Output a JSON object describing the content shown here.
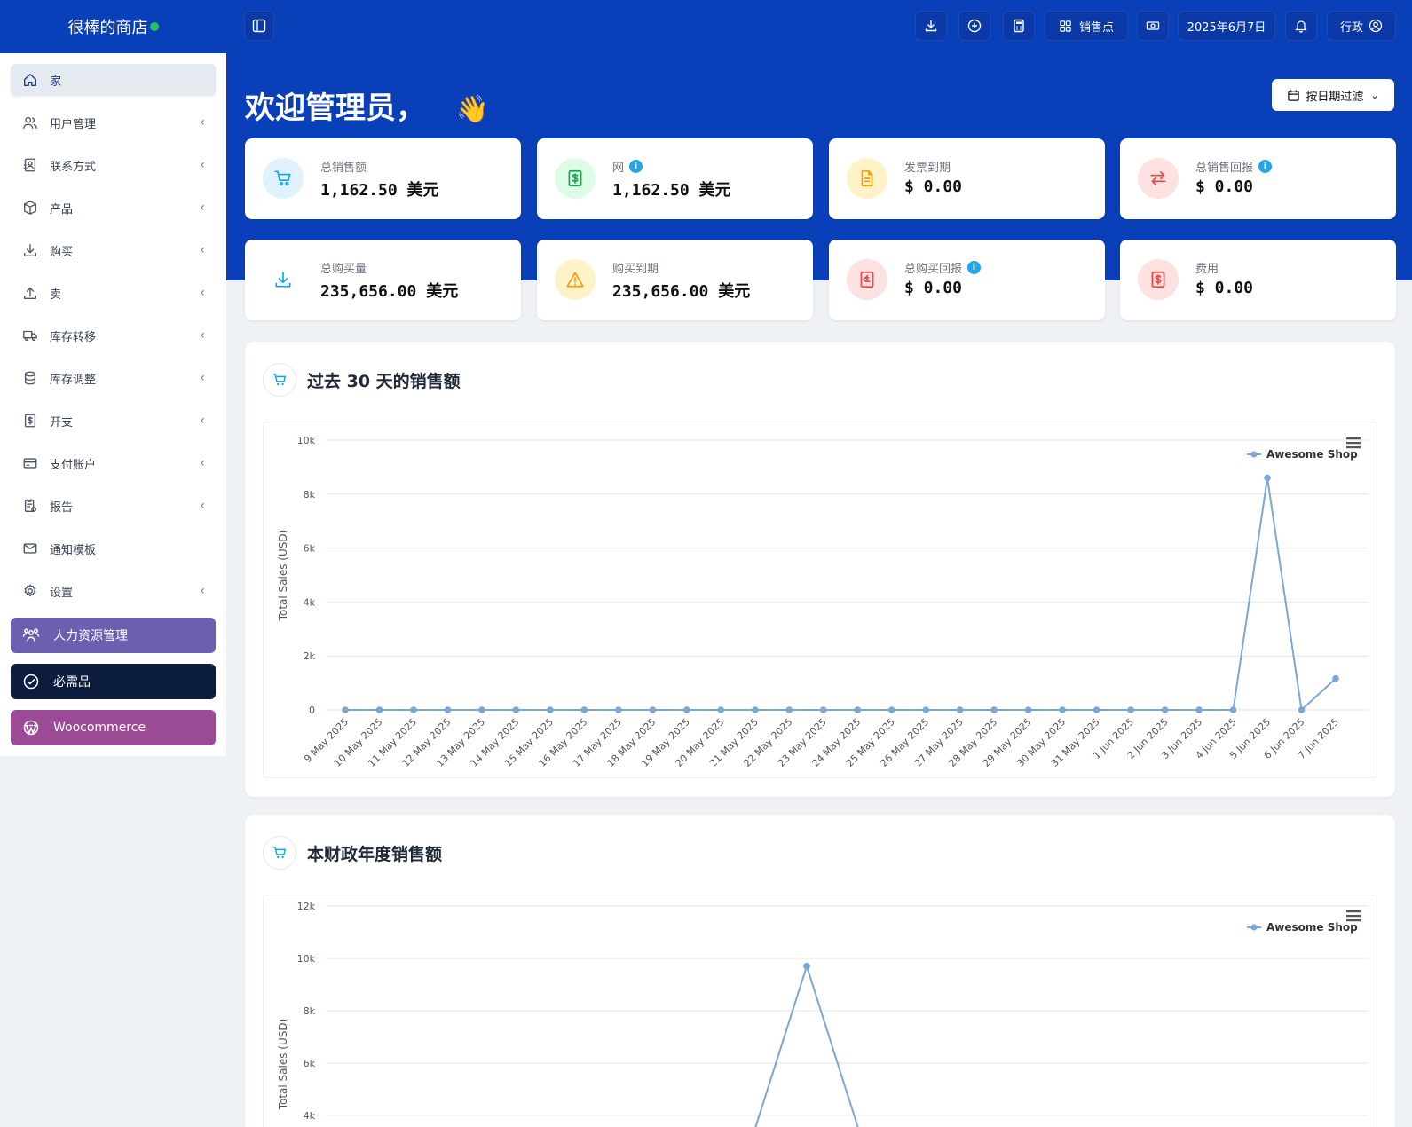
{
  "brand": {
    "name": "很棒的商店"
  },
  "sidebar": {
    "items": [
      {
        "label": "家",
        "icon": "home-icon",
        "active": true,
        "chevron": false
      },
      {
        "label": "用户管理",
        "icon": "users-icon",
        "chevron": true
      },
      {
        "label": "联系方式",
        "icon": "contact-icon",
        "chevron": true
      },
      {
        "label": "产品",
        "icon": "box-icon",
        "chevron": true
      },
      {
        "label": "购买",
        "icon": "download-icon",
        "chevron": true
      },
      {
        "label": "卖",
        "icon": "upload-icon",
        "chevron": true
      },
      {
        "label": "库存转移",
        "icon": "truck-icon",
        "chevron": true
      },
      {
        "label": "库存调整",
        "icon": "database-icon",
        "chevron": true
      },
      {
        "label": "开支",
        "icon": "receipt-icon",
        "chevron": true
      },
      {
        "label": "支付账户",
        "icon": "card-icon",
        "chevron": true
      },
      {
        "label": "报告",
        "icon": "report-icon",
        "chevron": true
      },
      {
        "label": "通知模板",
        "icon": "mail-icon",
        "chevron": false
      },
      {
        "label": "设置",
        "icon": "gear-icon",
        "chevron": true
      }
    ],
    "chevron_glyph": "‹",
    "special": [
      {
        "label": "人力资源管理",
        "icon": "team-icon",
        "color": "#6b5fb0"
      },
      {
        "label": "必需品",
        "icon": "check-circle-icon",
        "color": "#0b1c3d"
      },
      {
        "label": "Woocommerce",
        "icon": "wordpress-icon",
        "color": "#9b4a96"
      }
    ]
  },
  "header": {
    "pos_label": "销售点",
    "date": "2025年6月7日",
    "user": "行政"
  },
  "welcome": {
    "text": "欢迎管理员，",
    "emoji": "👋"
  },
  "filter": {
    "label": "按日期过滤"
  },
  "cards": [
    {
      "label": "总销售额",
      "value": "1,162.50 美元",
      "icon": "cart-icon",
      "tone": "#e0f2fe",
      "stroke": "#0ea5e9",
      "info": false
    },
    {
      "label": "网",
      "value": "1,162.50 美元",
      "icon": "money-icon",
      "tone": "#dcfce7",
      "stroke": "#16a34a",
      "info": true
    },
    {
      "label": "发票到期",
      "value": "$ 0.00",
      "icon": "file-icon",
      "tone": "#fef3c7",
      "stroke": "#f59e0b",
      "info": false
    },
    {
      "label": "总销售回报",
      "value": "$ 0.00",
      "icon": "swap-icon",
      "tone": "#fee2e2",
      "stroke": "#ef4444",
      "info": true
    },
    {
      "label": "总购买量",
      "value": "235,656.00 美元",
      "icon": "download-icon",
      "tone": "#ffffff",
      "stroke": "#0ea5e9",
      "info": false
    },
    {
      "label": "购买到期",
      "value": "235,656.00 美元",
      "icon": "warning-icon",
      "tone": "#fef3c7",
      "stroke": "#f59e0b",
      "info": false
    },
    {
      "label": "总购买回报",
      "value": "$ 0.00",
      "icon": "return-icon",
      "tone": "#fee2e2",
      "stroke": "#ef4444",
      "info": true
    },
    {
      "label": "费用",
      "value": "$ 0.00",
      "icon": "bill-icon",
      "tone": "#fee2e2",
      "stroke": "#ef4444",
      "info": false
    }
  ],
  "panels": {
    "last30_title": "过去 30 天的销售额",
    "fy_title": "本财政年度销售额"
  },
  "chart_data": [
    {
      "type": "line",
      "title": "过去 30 天的销售额",
      "ylabel": "Total Sales (USD)",
      "ylim": [
        0,
        10000
      ],
      "yticks": [
        "10k",
        "8k",
        "6k",
        "4k",
        "2k",
        "0"
      ],
      "x": [
        "9 May 2025",
        "10 May 2025",
        "11 May 2025",
        "12 May 2025",
        "13 May 2025",
        "14 May 2025",
        "15 May 2025",
        "16 May 2025",
        "17 May 2025",
        "18 May 2025",
        "19 May 2025",
        "20 May 2025",
        "21 May 2025",
        "22 May 2025",
        "23 May 2025",
        "24 May 2025",
        "25 May 2025",
        "26 May 2025",
        "27 May 2025",
        "28 May 2025",
        "29 May 2025",
        "30 May 2025",
        "31 May 2025",
        "1 Jun 2025",
        "2 Jun 2025",
        "3 Jun 2025",
        "4 Jun 2025",
        "5 Jun 2025",
        "6 Jun 2025",
        "7 Jun 2025"
      ],
      "series": [
        {
          "name": "Awesome Shop",
          "values": [
            0,
            0,
            0,
            0,
            0,
            0,
            0,
            0,
            0,
            0,
            0,
            0,
            0,
            0,
            0,
            0,
            0,
            0,
            0,
            0,
            0,
            0,
            0,
            0,
            0,
            0,
            0,
            8600,
            0,
            1160
          ],
          "color": "#7aa7d8"
        }
      ],
      "legend": "top-right"
    },
    {
      "type": "line",
      "title": "本财政年度销售额",
      "ylabel": "Total Sales (USD)",
      "ylim": [
        0,
        12000
      ],
      "yticks": [
        "12k",
        "10k",
        "8k",
        "6k",
        "4k"
      ],
      "series": [
        {
          "name": "Awesome Shop",
          "color": "#7aa7d8"
        }
      ],
      "visible_peak_value": 9700,
      "legend": "top-right"
    }
  ]
}
